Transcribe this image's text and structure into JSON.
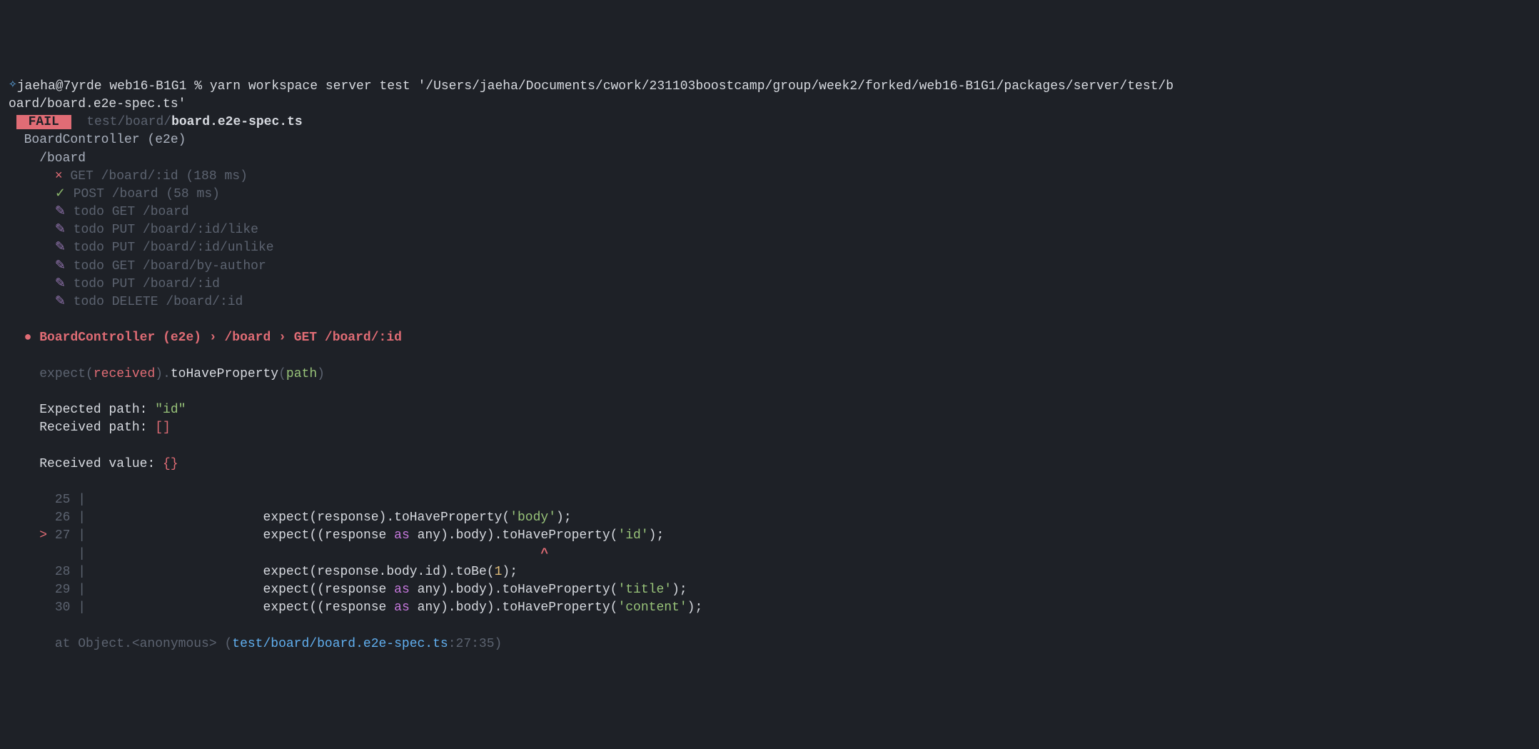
{
  "prompt": {
    "iconGlyph": "✧",
    "user_host": "jaeha@7yrde",
    "dir": "web16-B1G1",
    "separator": " % ",
    "command": "yarn workspace server test '/Users/jaeha/Documents/cwork/231103boostcamp/group/week2/forked/web16-B1G1/packages/server/test/b",
    "command_wrap": "oard/board.e2e-spec.ts'"
  },
  "fail": {
    "badge": "FAIL",
    "path_prefix": "test/board/",
    "file": "board.e2e-spec.ts"
  },
  "suite": {
    "root": "BoardController (e2e)",
    "child": "/board",
    "tests": [
      {
        "mark": "×",
        "markClass": "red",
        "text": "GET /board/:id",
        "timing": "(188 ms)"
      },
      {
        "mark": "✓",
        "markClass": "green-dim",
        "text": "POST /board",
        "timing": "(58 ms)"
      },
      {
        "mark": "✎",
        "markClass": "purple-dim",
        "text": "todo GET /board"
      },
      {
        "mark": "✎",
        "markClass": "purple-dim",
        "text": "todo PUT /board/:id/like"
      },
      {
        "mark": "✎",
        "markClass": "purple-dim",
        "text": "todo PUT /board/:id/unlike"
      },
      {
        "mark": "✎",
        "markClass": "purple-dim",
        "text": "todo GET /board/by-author"
      },
      {
        "mark": "✎",
        "markClass": "purple-dim",
        "text": "todo PUT /board/:id"
      },
      {
        "mark": "✎",
        "markClass": "purple-dim",
        "text": "todo DELETE /board/:id"
      }
    ]
  },
  "failure": {
    "bullet": "●",
    "breadcrumb": "BoardController (e2e) › /board › GET /board/:id",
    "assert_expect": "expect(",
    "assert_received": "received",
    "assert_close": ").",
    "assert_matcher": "toHaveProperty",
    "assert_open_path": "(",
    "assert_path": "path",
    "assert_end": ")",
    "expected_label": "Expected path: ",
    "expected_value": "\"id\"",
    "received_path_label": "Received path: ",
    "received_path_value": "[]",
    "received_value_label": "Received value: ",
    "received_value_value": "{}"
  },
  "code": {
    "lines": [
      {
        "num": "25",
        "prefix": " ",
        "content": ""
      },
      {
        "num": "26",
        "prefix": " ",
        "indent": "                       ",
        "tokens": [
          {
            "t": "expect(response).",
            "c": "white"
          },
          {
            "t": "toHaveProperty",
            "c": "white"
          },
          {
            "t": "(",
            "c": "white"
          },
          {
            "t": "'body'",
            "c": "green-str"
          },
          {
            "t": ");",
            "c": "white"
          }
        ]
      },
      {
        "num": "27",
        "prefix": ">",
        "indent": "                       ",
        "tokens": [
          {
            "t": "expect((response ",
            "c": "white"
          },
          {
            "t": "as",
            "c": "purple"
          },
          {
            "t": " any).body).",
            "c": "white"
          },
          {
            "t": "toHaveProperty",
            "c": "white"
          },
          {
            "t": "(",
            "c": "white"
          },
          {
            "t": "'id'",
            "c": "green-str"
          },
          {
            "t": ");",
            "c": "white"
          }
        ]
      },
      {
        "num": "",
        "prefix": " ",
        "caretIndent": "                                                           ",
        "caret": "^"
      },
      {
        "num": "28",
        "prefix": " ",
        "indent": "                       ",
        "tokens": [
          {
            "t": "expect(response.body.id).",
            "c": "white"
          },
          {
            "t": "toBe",
            "c": "white"
          },
          {
            "t": "(",
            "c": "white"
          },
          {
            "t": "1",
            "c": "yellow"
          },
          {
            "t": ");",
            "c": "white"
          }
        ]
      },
      {
        "num": "29",
        "prefix": " ",
        "indent": "                       ",
        "tokens": [
          {
            "t": "expect((response ",
            "c": "white"
          },
          {
            "t": "as",
            "c": "purple"
          },
          {
            "t": " any).body).",
            "c": "white"
          },
          {
            "t": "toHaveProperty",
            "c": "white"
          },
          {
            "t": "(",
            "c": "white"
          },
          {
            "t": "'title'",
            "c": "green-str"
          },
          {
            "t": ");",
            "c": "white"
          }
        ]
      },
      {
        "num": "30",
        "prefix": " ",
        "indent": "                       ",
        "tokens": [
          {
            "t": "expect((response ",
            "c": "white"
          },
          {
            "t": "as",
            "c": "purple"
          },
          {
            "t": " any).body).",
            "c": "white"
          },
          {
            "t": "toHaveProperty",
            "c": "white"
          },
          {
            "t": "(",
            "c": "white"
          },
          {
            "t": "'content'",
            "c": "green-str"
          },
          {
            "t": ");",
            "c": "white"
          }
        ]
      }
    ]
  },
  "stack": {
    "prefix": "at Object.<anonymous> (",
    "file": "test/board/board.e2e-spec.ts",
    "loc": ":27:35",
    "suffix": ")"
  }
}
